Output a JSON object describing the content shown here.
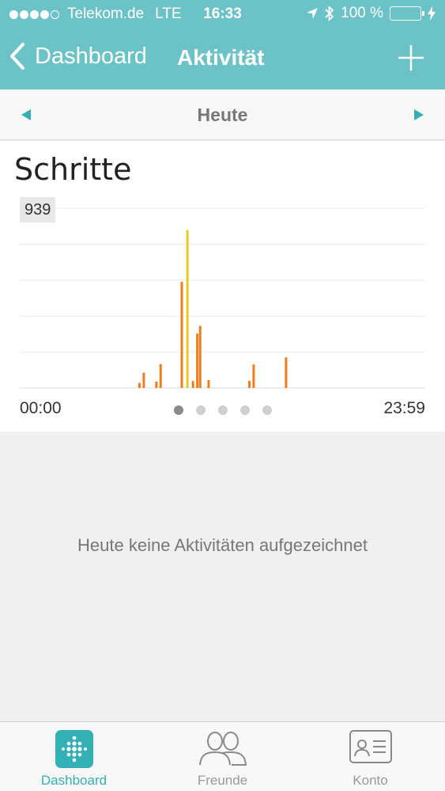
{
  "status_bar": {
    "carrier": "Telekom.de",
    "network": "LTE",
    "time": "16:33",
    "battery_percent": "100 %",
    "signal_bars_filled": 4,
    "signal_bars_total": 5
  },
  "navbar": {
    "back_label": "Dashboard",
    "title": "Aktivität"
  },
  "date_nav": {
    "label": "Heute"
  },
  "chart_card": {
    "title": "Schritte",
    "y_max_label": "939",
    "x_start_label": "00:00",
    "x_end_label": "23:59",
    "page_count": 5,
    "active_page": 0
  },
  "chart_data": {
    "type": "bar",
    "title": "Schritte",
    "x_unit": "time of day",
    "xlim": [
      "00:00",
      "23:59"
    ],
    "ylim": [
      0,
      939
    ],
    "grid": true,
    "x": [
      "07:05",
      "07:20",
      "08:05",
      "08:20",
      "09:35",
      "09:55",
      "10:15",
      "10:30",
      "10:40",
      "11:10",
      "13:35",
      "13:50",
      "15:45"
    ],
    "values": [
      27,
      80,
      33,
      125,
      555,
      825,
      37,
      284,
      325,
      41,
      37,
      123,
      160
    ],
    "highlight_color": "#f5c518",
    "bar_color": "#ef7d1a"
  },
  "empty_message": "Heute keine Aktivitäten aufgezeichnet",
  "tabbar": {
    "tabs": [
      {
        "label": "Dashboard",
        "icon": "dashboard-icon",
        "active": true
      },
      {
        "label": "Freunde",
        "icon": "friends-icon",
        "active": false
      },
      {
        "label": "Konto",
        "icon": "account-card-icon",
        "active": false
      }
    ]
  },
  "colors": {
    "accent": "#6cc3c7",
    "accent_dark": "#33b0b5",
    "bar": "#ef7d1a",
    "bar_highlight": "#f5c518",
    "battery": "#4cd964"
  }
}
